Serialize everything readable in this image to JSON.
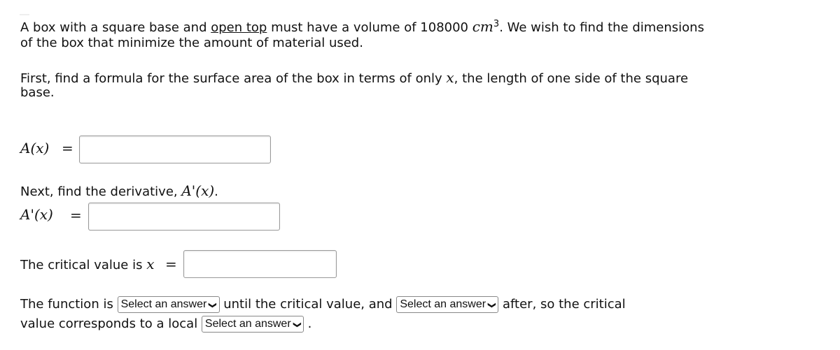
{
  "intro": {
    "p1_a": "A box with a square base and ",
    "p1_link": "open top",
    "p1_b": " must have a volume of 108000 ",
    "p1_unit": "cm",
    "p1_exp": "3",
    "p1_c": ". We wish to find the dimensions",
    "p1_line2": "of the box that minimize the amount of material used.",
    "p2_line1_a": "First, find a formula for the surface area of the box in terms of only ",
    "p2_var": "x",
    "p2_line1_b": ", the length of one side of the square",
    "p2_line2": "base."
  },
  "q1": {
    "label": "A(x)",
    "eq": "=",
    "value": ""
  },
  "q2": {
    "text": "Next, find the derivative, ",
    "math": "A'(x)",
    "end": ".",
    "label": "A'(x)",
    "eq": "=",
    "value": ""
  },
  "q3": {
    "text": "The critical value is ",
    "var": "x",
    "eq": "=",
    "value": ""
  },
  "q4": {
    "a": "The function is ",
    "b": " until the critical value, and ",
    "c": " after, so the critical",
    "d": "value corresponds to a local ",
    "e": ".",
    "select1": "Select an answer",
    "select2": "Select an answer",
    "select3": "Select an answer"
  }
}
